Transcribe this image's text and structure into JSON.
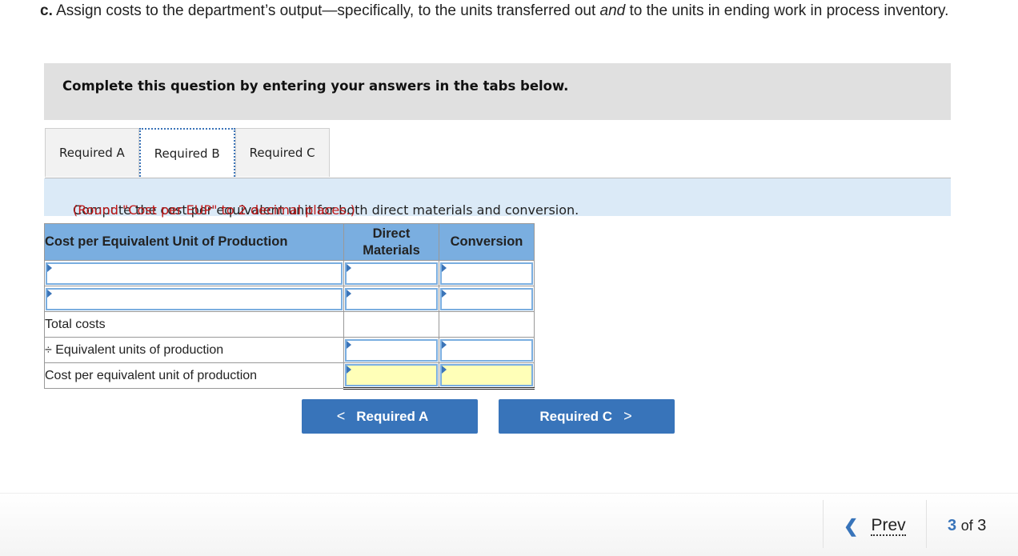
{
  "prompt": {
    "label": "c.",
    "text_before": " Assign costs to the department’s output—specifically, to the units transferred out ",
    "emph": "and",
    "text_after": " to the units in ending work in process inventory."
  },
  "banner": "Complete this question by entering your answers in the tabs below.",
  "tabs": [
    {
      "label": "Required A",
      "active": false
    },
    {
      "label": "Required B",
      "active": true
    },
    {
      "label": "Required C",
      "active": false
    }
  ],
  "instruction": {
    "text": "Compute the cost per equivalent unit for both direct materials and conversion.",
    "note": "(Round \"Cost per EUP\" to 2 decimal places.)"
  },
  "table": {
    "headers": [
      "Cost per Equivalent Unit of Production",
      "Direct Materials",
      "Conversion"
    ],
    "rows": [
      {
        "label": "",
        "label_input": true,
        "dm": "",
        "conv": ""
      },
      {
        "label": "",
        "label_input": true,
        "dm": "",
        "conv": ""
      },
      {
        "label": "Total costs",
        "label_input": false,
        "dm": null,
        "conv": null
      },
      {
        "label": "÷ Equivalent units of production",
        "label_input": false,
        "dm": "",
        "conv": ""
      },
      {
        "label": "Cost per equivalent unit of production",
        "label_input": false,
        "dm": "",
        "conv": ""
      }
    ]
  },
  "nav": {
    "prev_label": "Required A",
    "next_label": "Required C"
  },
  "footer": {
    "prev": "Prev",
    "current": "3",
    "of": "of",
    "total": "3"
  },
  "colors": {
    "accent": "#3874ba",
    "header_bg": "#7aaee0",
    "note_red": "#c01818",
    "answer_yellow": "#ffffb8"
  }
}
